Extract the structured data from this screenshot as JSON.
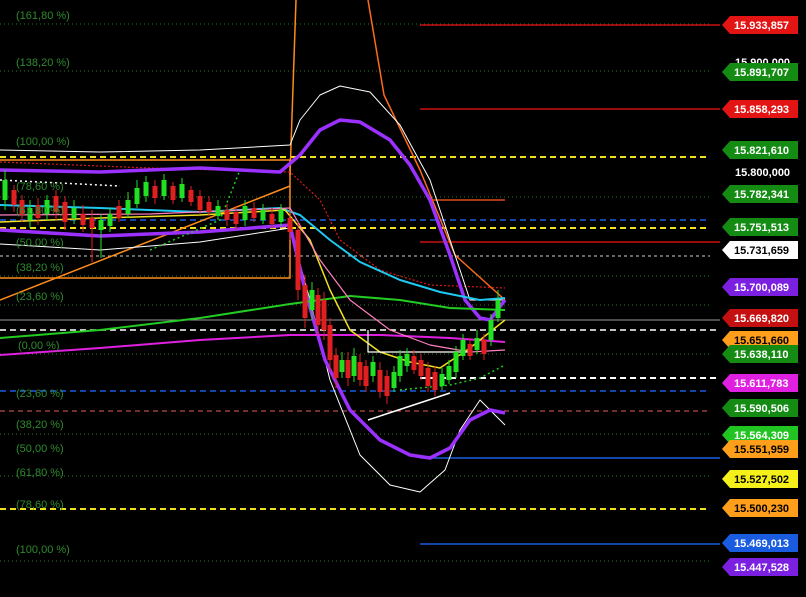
{
  "chart_data": {
    "type": "candlestick",
    "background": "#000000",
    "y_axis_ticks": [
      "15.900,000",
      "15.800,000"
    ],
    "fib_levels_left": [
      {
        "label": "(161,80 %)",
        "color": "#2e8b2e"
      },
      {
        "label": "(138,20 %)",
        "color": "#2e8b2e"
      },
      {
        "label": "(100,00 %)",
        "color": "#2e8b2e"
      },
      {
        "label": "(78,60 %)",
        "color": "#2e8b2e"
      },
      {
        "label": "(61,80 %)",
        "color": "#2e8b2e"
      },
      {
        "label": "(50,00 %)",
        "color": "#2e8b2e"
      },
      {
        "label": "(38,20 %)",
        "color": "#2e8b2e"
      },
      {
        "label": "(23,60 %)",
        "color": "#2e8b2e"
      },
      {
        "label": "(0,00 %)",
        "color": "#2e8b2e"
      },
      {
        "label": "(23,60 %)",
        "color": "#2e8b2e"
      },
      {
        "label": "(38,20 %)",
        "color": "#2e8b2e"
      },
      {
        "label": "(50,00 %)",
        "color": "#2e8b2e"
      },
      {
        "label": "(61,80 %)",
        "color": "#2e8b2e"
      },
      {
        "label": "(78,60 %)",
        "color": "#2e8b2e"
      },
      {
        "label": "(100,00 %)",
        "color": "#2e8b2e"
      }
    ],
    "price_tags": [
      {
        "value": "15.933,857",
        "bg": "#e31414",
        "fg": "#ffffff"
      },
      {
        "value": "15.891,707",
        "bg": "#148c14",
        "fg": "#ffffff"
      },
      {
        "value": "15.858,293",
        "bg": "#e31414",
        "fg": "#ffffff"
      },
      {
        "value": "15.821,610",
        "bg": "#148c14",
        "fg": "#ffffff"
      },
      {
        "value": "15.782,341",
        "bg": "#148c14",
        "fg": "#ffffff"
      },
      {
        "value": "15.751,513",
        "bg": "#148c14",
        "fg": "#ffffff"
      },
      {
        "value": "15.731,659",
        "bg": "#ffffff",
        "fg": "#000000"
      },
      {
        "value": "15.700,089",
        "bg": "#7b1fe0",
        "fg": "#ffffff"
      },
      {
        "value": "15.669,820",
        "bg": "#c41010",
        "fg": "#ffffff"
      },
      {
        "value": "15.651,660",
        "bg": "#ff9e1a",
        "fg": "#000000"
      },
      {
        "value": "15.638,110",
        "bg": "#148c14",
        "fg": "#ffffff"
      },
      {
        "value": "15.611,783",
        "bg": "#e020e0",
        "fg": "#ffffff"
      },
      {
        "value": "15.590,506",
        "bg": "#148c14",
        "fg": "#ffffff"
      },
      {
        "value": "15.564,309",
        "bg": "#22c422",
        "fg": "#ffffff"
      },
      {
        "value": "15.551,959",
        "bg": "#ff9e1a",
        "fg": "#000000"
      },
      {
        "value": "15.527,502",
        "bg": "#f5f01a",
        "fg": "#000000"
      },
      {
        "value": "15.500,230",
        "bg": "#ff9e1a",
        "fg": "#000000"
      },
      {
        "value": "15.469,013",
        "bg": "#1a5ce0",
        "fg": "#ffffff"
      },
      {
        "value": "15.447,528",
        "bg": "#7b1fe0",
        "fg": "#ffffff"
      }
    ],
    "colors": {
      "candle_up": "#22e022",
      "candle_down": "#e02020",
      "bollinger": "#ffffff",
      "envelope": "#9b30ff",
      "ma_cyan": "#1ec8f0",
      "ma_green": "#22cc22",
      "ma_magenta": "#e020e0",
      "ma_yellow": "#f0e020",
      "ma_orange": "#ff8c1a"
    }
  }
}
